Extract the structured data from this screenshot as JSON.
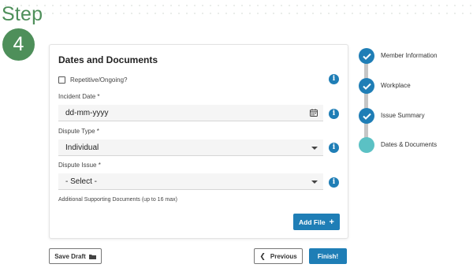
{
  "step": {
    "label": "Step",
    "number": "4"
  },
  "form": {
    "title": "Dates and Documents",
    "repetitive_label": "Repetitive/Ongoing?",
    "incident_date_label": "Incident Date *",
    "incident_date_placeholder": "dd-mm-yyyy",
    "dispute_type_label": "Dispute Type *",
    "dispute_type_value": "Individual",
    "dispute_issue_label": "Dispute Issue *",
    "dispute_issue_value": "- Select -",
    "supporting_docs_label": "Additional Supporting Documents (up to 16 max)",
    "add_file_label": "Add File",
    "info_glyph": "i"
  },
  "buttons": {
    "save_draft": "Save Draft",
    "previous": "Previous",
    "finish": "Finish!"
  },
  "stepper": {
    "steps": [
      {
        "label": "Member Information",
        "state": "complete"
      },
      {
        "label": "Workplace",
        "state": "complete"
      },
      {
        "label": "Issue Summary",
        "state": "complete"
      },
      {
        "label": "Dates & Documents",
        "state": "current"
      }
    ]
  },
  "colors": {
    "brand_green": "#4e8f5a",
    "primary_blue": "#1f7eb6",
    "current_step_teal": "#5bc1c4",
    "connector_gray": "#c6c6c6"
  }
}
